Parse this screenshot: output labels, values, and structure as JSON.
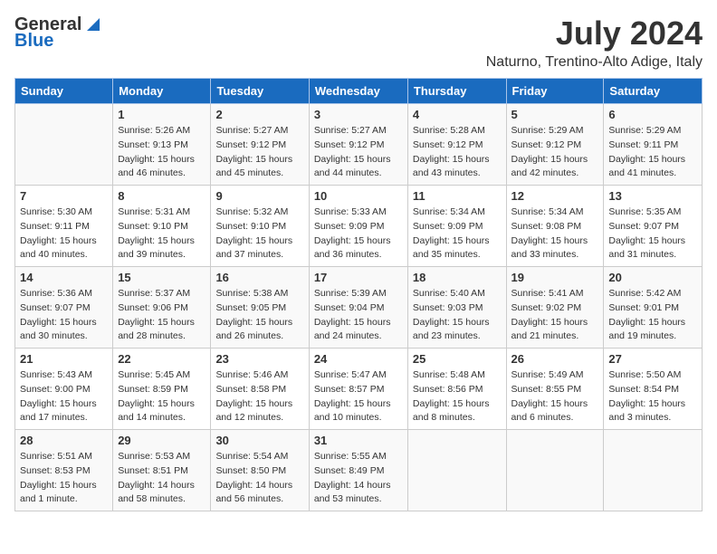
{
  "logo": {
    "line1": "General",
    "line2": "Blue"
  },
  "title": "July 2024",
  "location": "Naturno, Trentino-Alto Adige, Italy",
  "days_header": [
    "Sunday",
    "Monday",
    "Tuesday",
    "Wednesday",
    "Thursday",
    "Friday",
    "Saturday"
  ],
  "weeks": [
    [
      {
        "day": "",
        "info": ""
      },
      {
        "day": "1",
        "info": "Sunrise: 5:26 AM\nSunset: 9:13 PM\nDaylight: 15 hours\nand 46 minutes."
      },
      {
        "day": "2",
        "info": "Sunrise: 5:27 AM\nSunset: 9:12 PM\nDaylight: 15 hours\nand 45 minutes."
      },
      {
        "day": "3",
        "info": "Sunrise: 5:27 AM\nSunset: 9:12 PM\nDaylight: 15 hours\nand 44 minutes."
      },
      {
        "day": "4",
        "info": "Sunrise: 5:28 AM\nSunset: 9:12 PM\nDaylight: 15 hours\nand 43 minutes."
      },
      {
        "day": "5",
        "info": "Sunrise: 5:29 AM\nSunset: 9:12 PM\nDaylight: 15 hours\nand 42 minutes."
      },
      {
        "day": "6",
        "info": "Sunrise: 5:29 AM\nSunset: 9:11 PM\nDaylight: 15 hours\nand 41 minutes."
      }
    ],
    [
      {
        "day": "7",
        "info": "Sunrise: 5:30 AM\nSunset: 9:11 PM\nDaylight: 15 hours\nand 40 minutes."
      },
      {
        "day": "8",
        "info": "Sunrise: 5:31 AM\nSunset: 9:10 PM\nDaylight: 15 hours\nand 39 minutes."
      },
      {
        "day": "9",
        "info": "Sunrise: 5:32 AM\nSunset: 9:10 PM\nDaylight: 15 hours\nand 37 minutes."
      },
      {
        "day": "10",
        "info": "Sunrise: 5:33 AM\nSunset: 9:09 PM\nDaylight: 15 hours\nand 36 minutes."
      },
      {
        "day": "11",
        "info": "Sunrise: 5:34 AM\nSunset: 9:09 PM\nDaylight: 15 hours\nand 35 minutes."
      },
      {
        "day": "12",
        "info": "Sunrise: 5:34 AM\nSunset: 9:08 PM\nDaylight: 15 hours\nand 33 minutes."
      },
      {
        "day": "13",
        "info": "Sunrise: 5:35 AM\nSunset: 9:07 PM\nDaylight: 15 hours\nand 31 minutes."
      }
    ],
    [
      {
        "day": "14",
        "info": "Sunrise: 5:36 AM\nSunset: 9:07 PM\nDaylight: 15 hours\nand 30 minutes."
      },
      {
        "day": "15",
        "info": "Sunrise: 5:37 AM\nSunset: 9:06 PM\nDaylight: 15 hours\nand 28 minutes."
      },
      {
        "day": "16",
        "info": "Sunrise: 5:38 AM\nSunset: 9:05 PM\nDaylight: 15 hours\nand 26 minutes."
      },
      {
        "day": "17",
        "info": "Sunrise: 5:39 AM\nSunset: 9:04 PM\nDaylight: 15 hours\nand 24 minutes."
      },
      {
        "day": "18",
        "info": "Sunrise: 5:40 AM\nSunset: 9:03 PM\nDaylight: 15 hours\nand 23 minutes."
      },
      {
        "day": "19",
        "info": "Sunrise: 5:41 AM\nSunset: 9:02 PM\nDaylight: 15 hours\nand 21 minutes."
      },
      {
        "day": "20",
        "info": "Sunrise: 5:42 AM\nSunset: 9:01 PM\nDaylight: 15 hours\nand 19 minutes."
      }
    ],
    [
      {
        "day": "21",
        "info": "Sunrise: 5:43 AM\nSunset: 9:00 PM\nDaylight: 15 hours\nand 17 minutes."
      },
      {
        "day": "22",
        "info": "Sunrise: 5:45 AM\nSunset: 8:59 PM\nDaylight: 15 hours\nand 14 minutes."
      },
      {
        "day": "23",
        "info": "Sunrise: 5:46 AM\nSunset: 8:58 PM\nDaylight: 15 hours\nand 12 minutes."
      },
      {
        "day": "24",
        "info": "Sunrise: 5:47 AM\nSunset: 8:57 PM\nDaylight: 15 hours\nand 10 minutes."
      },
      {
        "day": "25",
        "info": "Sunrise: 5:48 AM\nSunset: 8:56 PM\nDaylight: 15 hours\nand 8 minutes."
      },
      {
        "day": "26",
        "info": "Sunrise: 5:49 AM\nSunset: 8:55 PM\nDaylight: 15 hours\nand 6 minutes."
      },
      {
        "day": "27",
        "info": "Sunrise: 5:50 AM\nSunset: 8:54 PM\nDaylight: 15 hours\nand 3 minutes."
      }
    ],
    [
      {
        "day": "28",
        "info": "Sunrise: 5:51 AM\nSunset: 8:53 PM\nDaylight: 15 hours\nand 1 minute."
      },
      {
        "day": "29",
        "info": "Sunrise: 5:53 AM\nSunset: 8:51 PM\nDaylight: 14 hours\nand 58 minutes."
      },
      {
        "day": "30",
        "info": "Sunrise: 5:54 AM\nSunset: 8:50 PM\nDaylight: 14 hours\nand 56 minutes."
      },
      {
        "day": "31",
        "info": "Sunrise: 5:55 AM\nSunset: 8:49 PM\nDaylight: 14 hours\nand 53 minutes."
      },
      {
        "day": "",
        "info": ""
      },
      {
        "day": "",
        "info": ""
      },
      {
        "day": "",
        "info": ""
      }
    ]
  ]
}
